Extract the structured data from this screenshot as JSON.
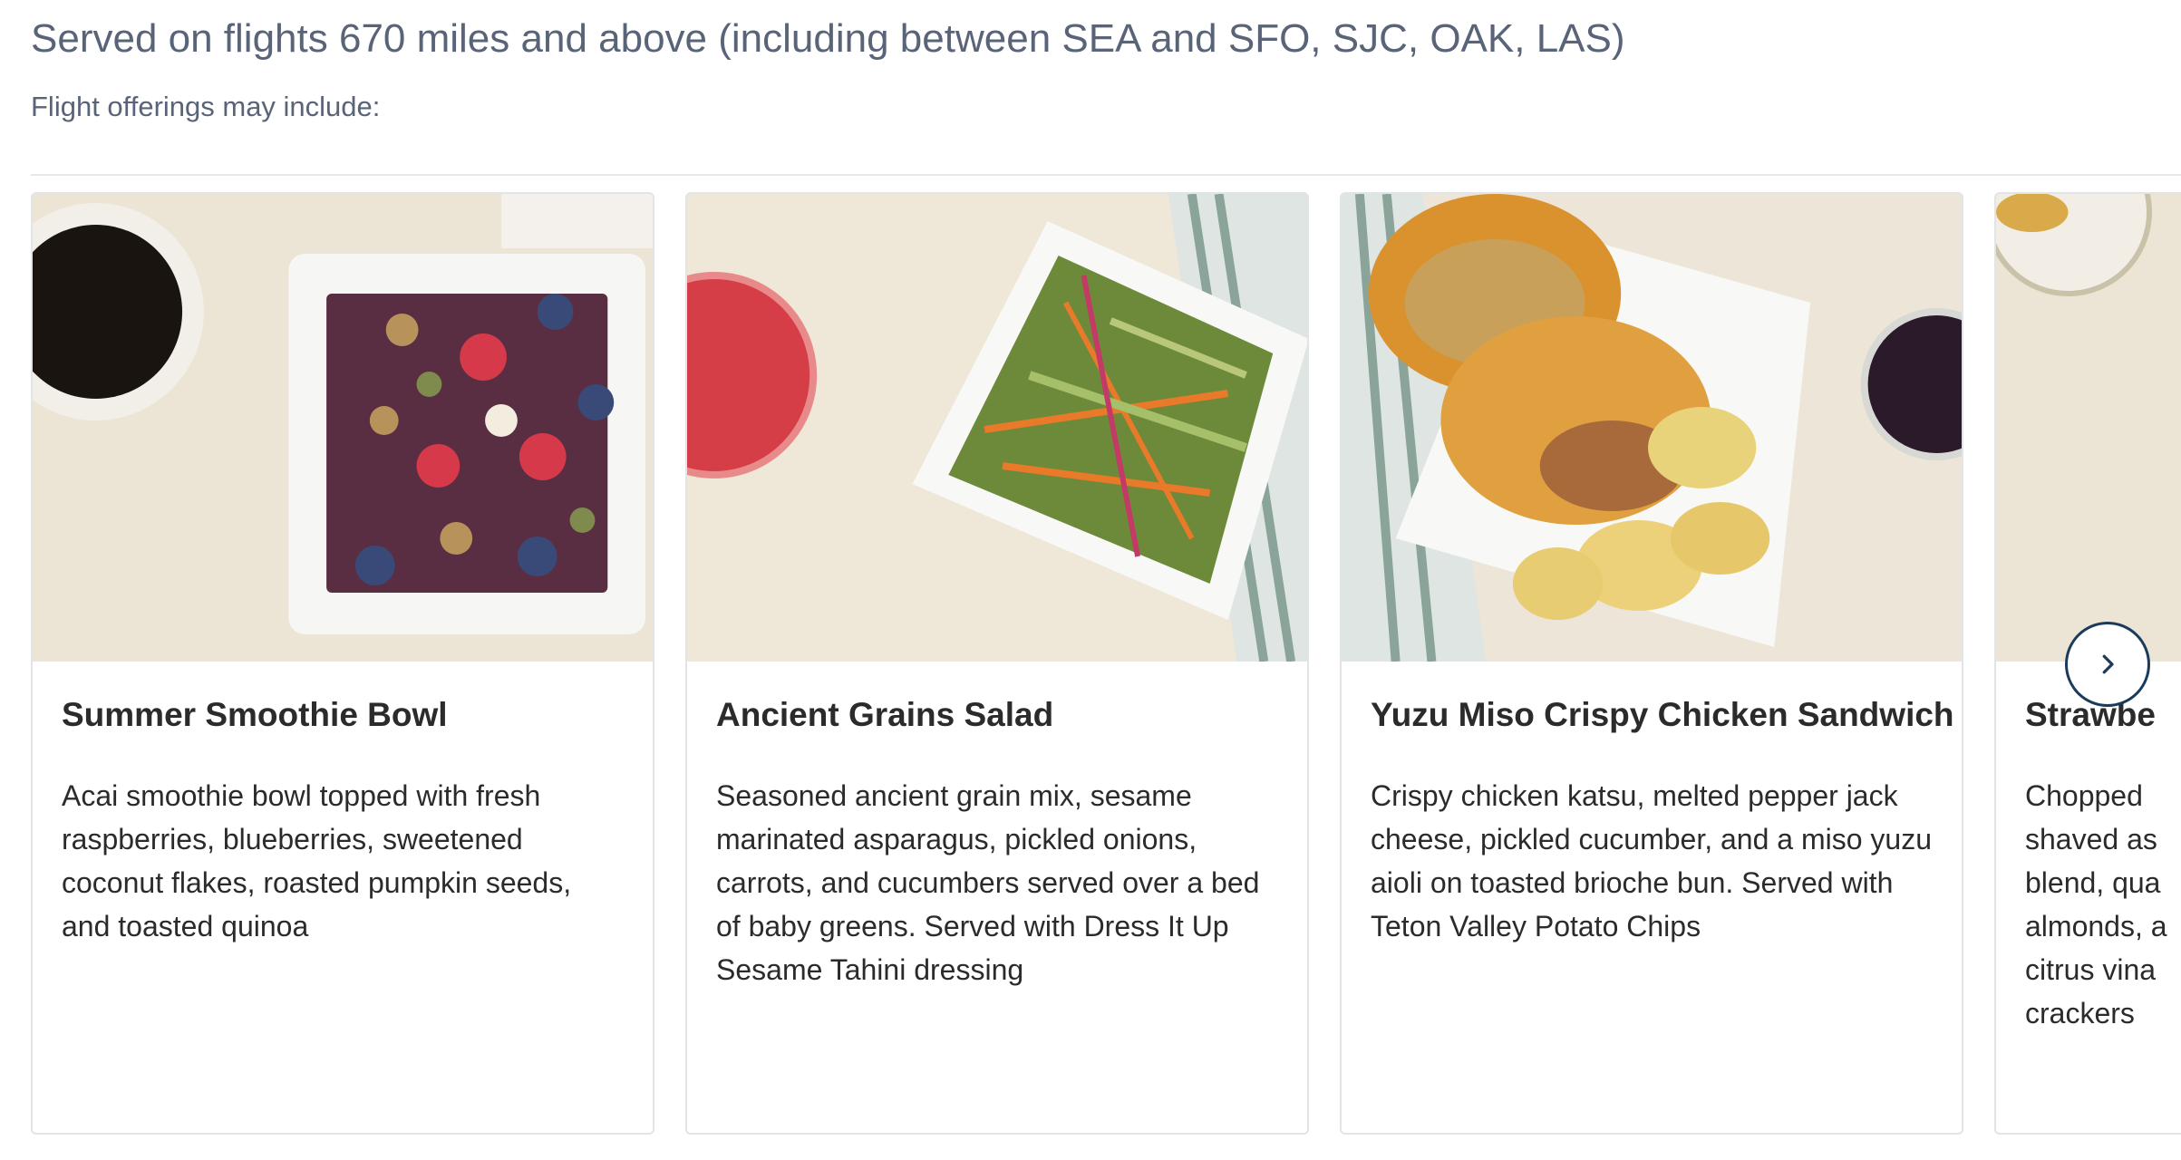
{
  "header": {
    "title": "Served on flights 670 miles and above (including between SEA and SFO, SJC, OAK, LAS)",
    "subtitle": "Flight offerings may include:"
  },
  "cards": [
    {
      "title": "Summer Smoothie Bowl",
      "description": "Acai smoothie bowl topped with fresh raspberries, blueberries, sweetened coconut flakes, roasted pumpkin seeds, and toasted quinoa",
      "image": "smoothie-bowl-photo"
    },
    {
      "title": "Ancient Grains Salad",
      "description": "Seasoned ancient grain mix, sesame marinated asparagus, pickled onions, carrots, and cucumbers served over a bed of baby greens. Served with Dress It Up Sesame Tahini dressing",
      "image": "grain-salad-photo"
    },
    {
      "title": "Yuzu Miso Crispy Chicken Sandwich",
      "description": "Crispy chicken katsu, melted pepper jack cheese, pickled cucumber, and a miso yuzu aioli on toasted brioche bun. Served with Teton Valley Potato Chips",
      "image": "chicken-sandwich-photo"
    },
    {
      "title": "Strawbe",
      "description": "Chopped shaved as blend, qua almonds, a citrus vina crackers",
      "image": "partial-card-photo"
    }
  ],
  "carousel": {
    "next_icon": "chevron-right-icon"
  },
  "colors": {
    "heading_text": "#5a6478",
    "body_text": "#2b2b2b",
    "border": "#e1e4e8",
    "nav_button": "#1a3b5c"
  }
}
